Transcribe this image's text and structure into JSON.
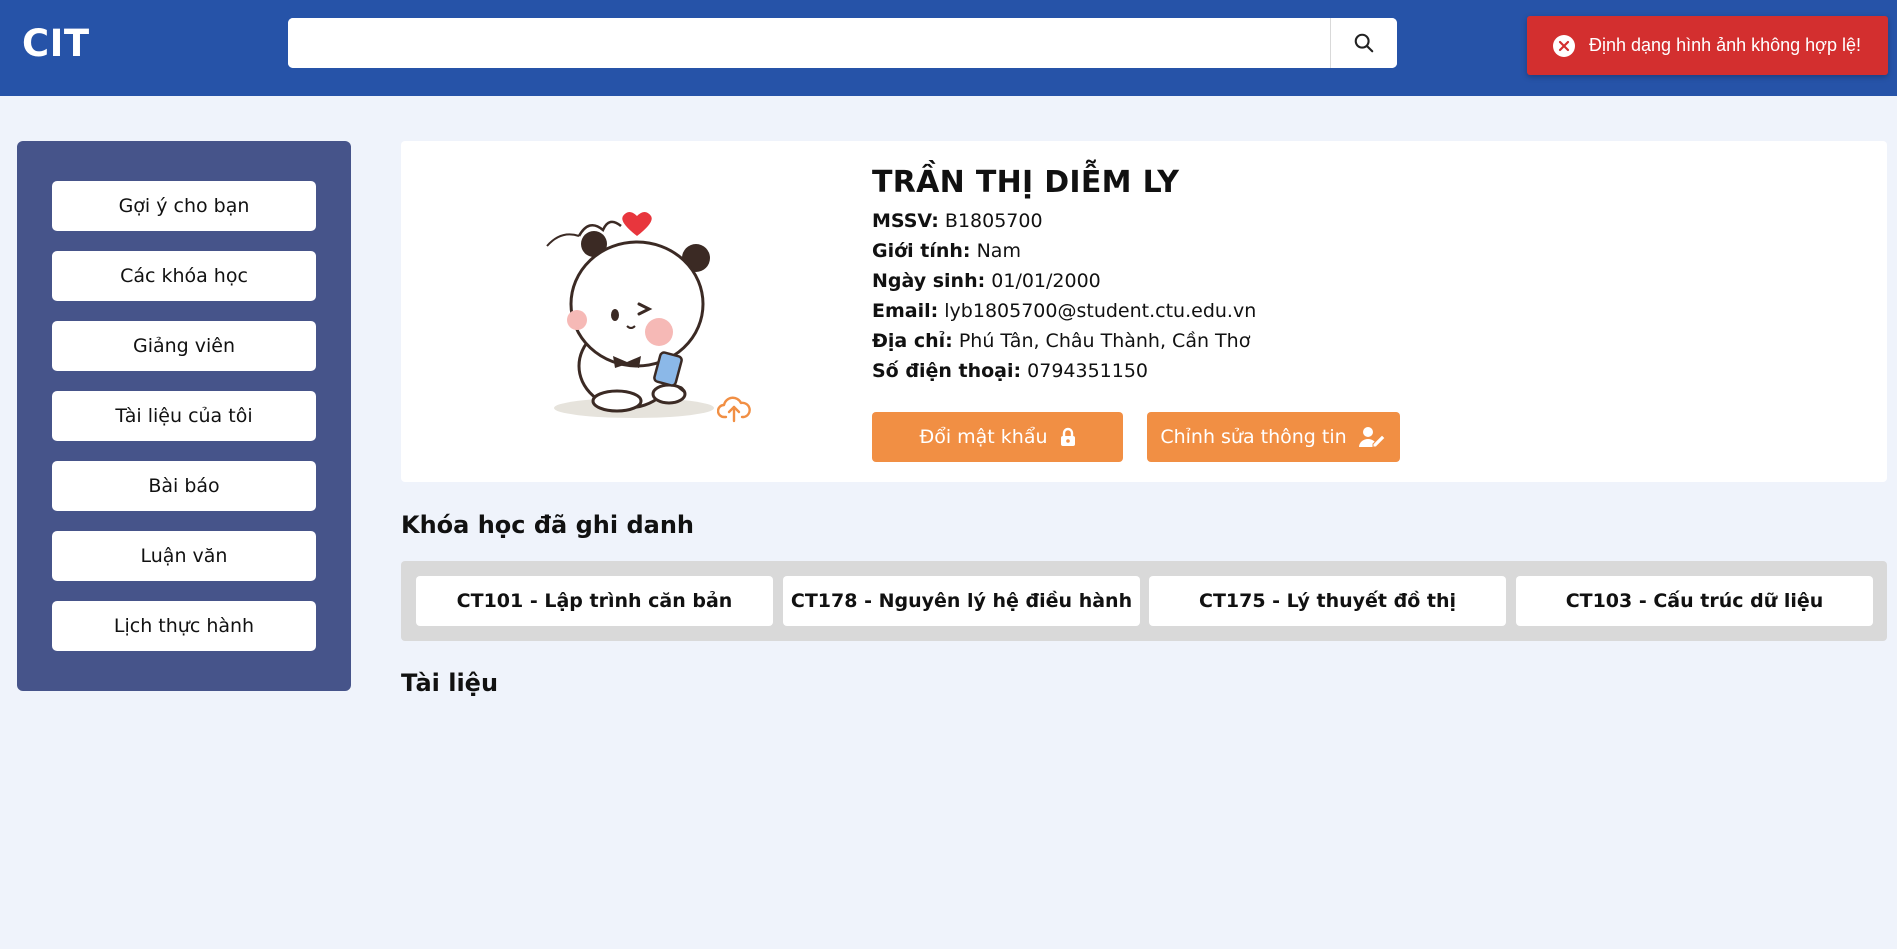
{
  "header": {
    "logo": "CIT",
    "search": {
      "value": "",
      "placeholder": ""
    },
    "search_icon": "search-icon"
  },
  "toast": {
    "type": "error",
    "icon": "close-circle-icon",
    "message": "Định dạng hình ảnh không hợp lệ!"
  },
  "sidebar": {
    "items": [
      {
        "label": "Gợi ý cho bạn"
      },
      {
        "label": "Các khóa học"
      },
      {
        "label": "Giảng viên"
      },
      {
        "label": "Tài liệu của tôi"
      },
      {
        "label": "Bài báo"
      },
      {
        "label": "Luận văn"
      },
      {
        "label": "Lịch thực hành"
      }
    ]
  },
  "profile": {
    "name": "TRẦN THỊ DIỄM LY",
    "fields": {
      "mssv": {
        "label": "MSSV:",
        "value": "B1805700"
      },
      "gender": {
        "label": "Giới tính:",
        "value": "Nam"
      },
      "dob": {
        "label": "Ngày sinh:",
        "value": "01/01/2000"
      },
      "email": {
        "label": "Email:",
        "value": "lyb1805700@student.ctu.edu.vn"
      },
      "address": {
        "label": "Địa chỉ:",
        "value": "Phú Tân, Châu Thành, Cần Thơ"
      },
      "phone": {
        "label": "Số điện thoại:",
        "value": "0794351150"
      }
    },
    "buttons": {
      "change_password": "Đổi mật khẩu",
      "edit_info": "Chỉnh sửa thông tin"
    },
    "avatar_icon": "panda-avatar",
    "upload_icon": "cloud-upload-icon"
  },
  "enrolled": {
    "title": "Khóa học đã ghi danh",
    "courses": [
      {
        "label": "CT101 - Lập trình căn bản"
      },
      {
        "label": "CT178 - Nguyên lý hệ điều hành"
      },
      {
        "label": "CT175 - Lý thuyết đồ thị"
      },
      {
        "label": "CT103 - Cấu trúc dữ liệu"
      }
    ]
  },
  "documents": {
    "title": "Tài liệu"
  },
  "colors": {
    "header_bg": "#2653a8",
    "sidebar_bg": "#46548a",
    "accent_orange": "#f18f44",
    "toast_red": "#d32f2f",
    "page_bg": "#eff3fb"
  }
}
